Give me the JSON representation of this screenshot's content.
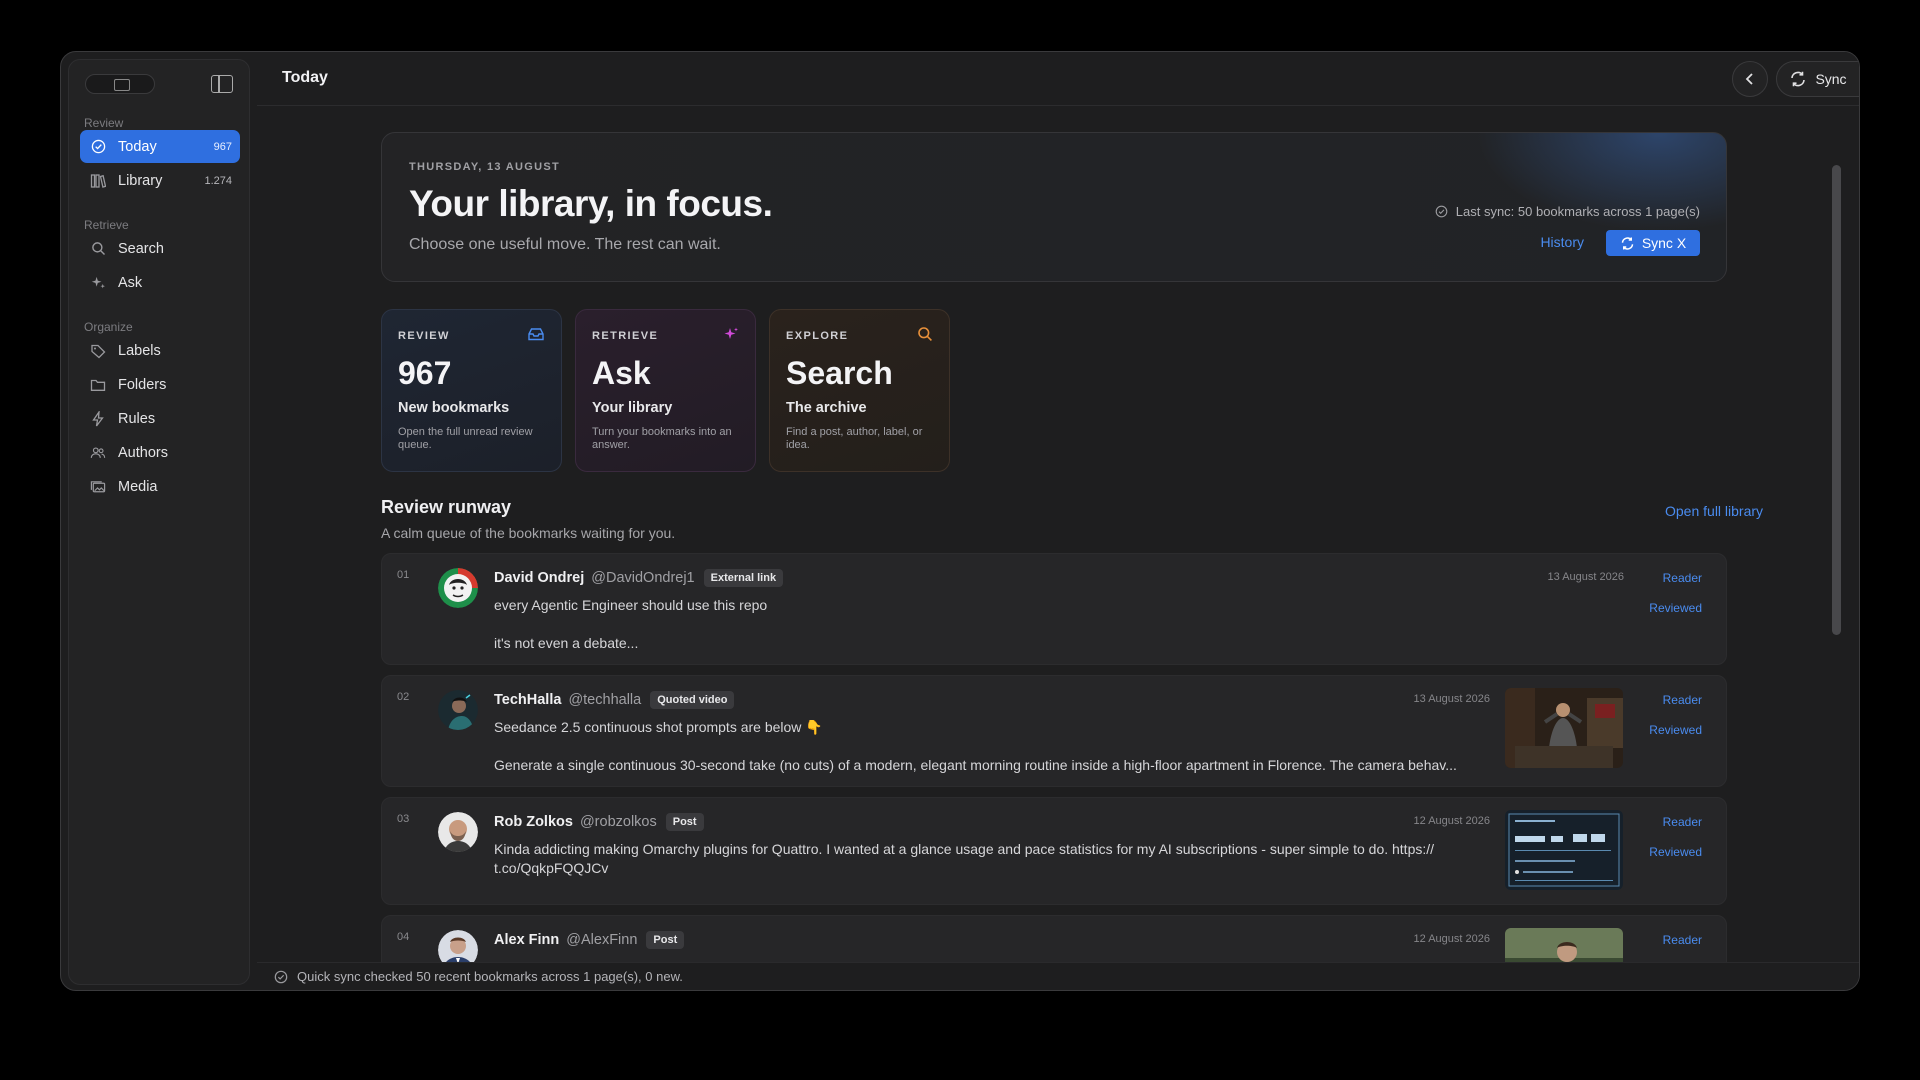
{
  "header": {
    "title": "Today",
    "sync_label": "Sync"
  },
  "sidebar": {
    "sections": [
      {
        "title": "Review"
      },
      {
        "title": "Retrieve"
      },
      {
        "title": "Organize"
      }
    ],
    "items": [
      {
        "label": "Today",
        "count": "967",
        "icon": "check-circle-icon"
      },
      {
        "label": "Library",
        "count": "1.274",
        "icon": "library-icon"
      },
      {
        "label": "Search",
        "icon": "search-icon"
      },
      {
        "label": "Ask",
        "icon": "sparkle-icon"
      },
      {
        "label": "Labels",
        "icon": "tag-icon"
      },
      {
        "label": "Folders",
        "icon": "folder-icon"
      },
      {
        "label": "Rules",
        "icon": "bolt-icon"
      },
      {
        "label": "Authors",
        "icon": "users-icon"
      },
      {
        "label": "Media",
        "icon": "media-icon"
      }
    ]
  },
  "hero": {
    "date": "THURSDAY, 13 AUGUST",
    "title": "Your library, in focus.",
    "subtitle": "Choose one useful move. The rest can wait.",
    "sync_status": "Last sync: 50 bookmarks across 1 page(s)",
    "history_label": "History",
    "syncx_label": "Sync X"
  },
  "cards": [
    {
      "label": "REVIEW",
      "big": "967",
      "sub": "New bookmarks",
      "desc": "Open the full unread review queue.",
      "icon": "inbox-icon",
      "icon_color": "#4a8cf0"
    },
    {
      "label": "RETRIEVE",
      "big": "Ask",
      "sub": "Your library",
      "desc": "Turn your bookmarks into an answer.",
      "icon": "sparkle-icon",
      "icon_color": "#d04ad8"
    },
    {
      "label": "EXPLORE",
      "big": "Search",
      "sub": "The archive",
      "desc": "Find a post, author, label, or idea.",
      "icon": "search-icon",
      "icon_color": "#e8903a"
    }
  ],
  "runway": {
    "title": "Review runway",
    "subtitle": "A calm queue of the bookmarks waiting for you.",
    "open_library": "Open full library",
    "reader_label": "Reader",
    "reviewed_label": "Reviewed",
    "rows": [
      {
        "num": "01",
        "name": "David Ondrej",
        "handle": "@DavidOndrej1",
        "tag": "External link",
        "line1": "every Agentic Engineer should use this repo",
        "line2": "it's not even a debate...",
        "date": "13 August 2026"
      },
      {
        "num": "02",
        "name": "TechHalla",
        "handle": "@techhalla",
        "tag": "Quoted video",
        "line1": "Seedance 2.5 continuous shot prompts are below 👇",
        "line2": "Generate a single continuous 30-second take (no cuts) of a modern, elegant morning routine inside a high-floor apartment in Florence. The camera behav...",
        "date": "13 August 2026"
      },
      {
        "num": "03",
        "name": "Rob Zolkos",
        "handle": "@robzolkos",
        "tag": "Post",
        "line1": "Kinda addicting making Omarchy plugins for Quattro.  I wanted at a glance usage and pace statistics for my AI subscriptions - super simple to do. https://",
        "line2": "t.co/QqkpFQQJCv",
        "date": "12 August 2026"
      },
      {
        "num": "04",
        "name": "Alex Finn",
        "handle": "@AlexFinn",
        "tag": "Post",
        "date": "12 August 2026"
      }
    ]
  },
  "status": {
    "text": "Quick sync checked 50 recent bookmarks across 1 page(s), 0 new."
  },
  "colors": {
    "accent": "#2f6fe0",
    "link": "#4a8cf0",
    "background": "#1e1e1f"
  }
}
